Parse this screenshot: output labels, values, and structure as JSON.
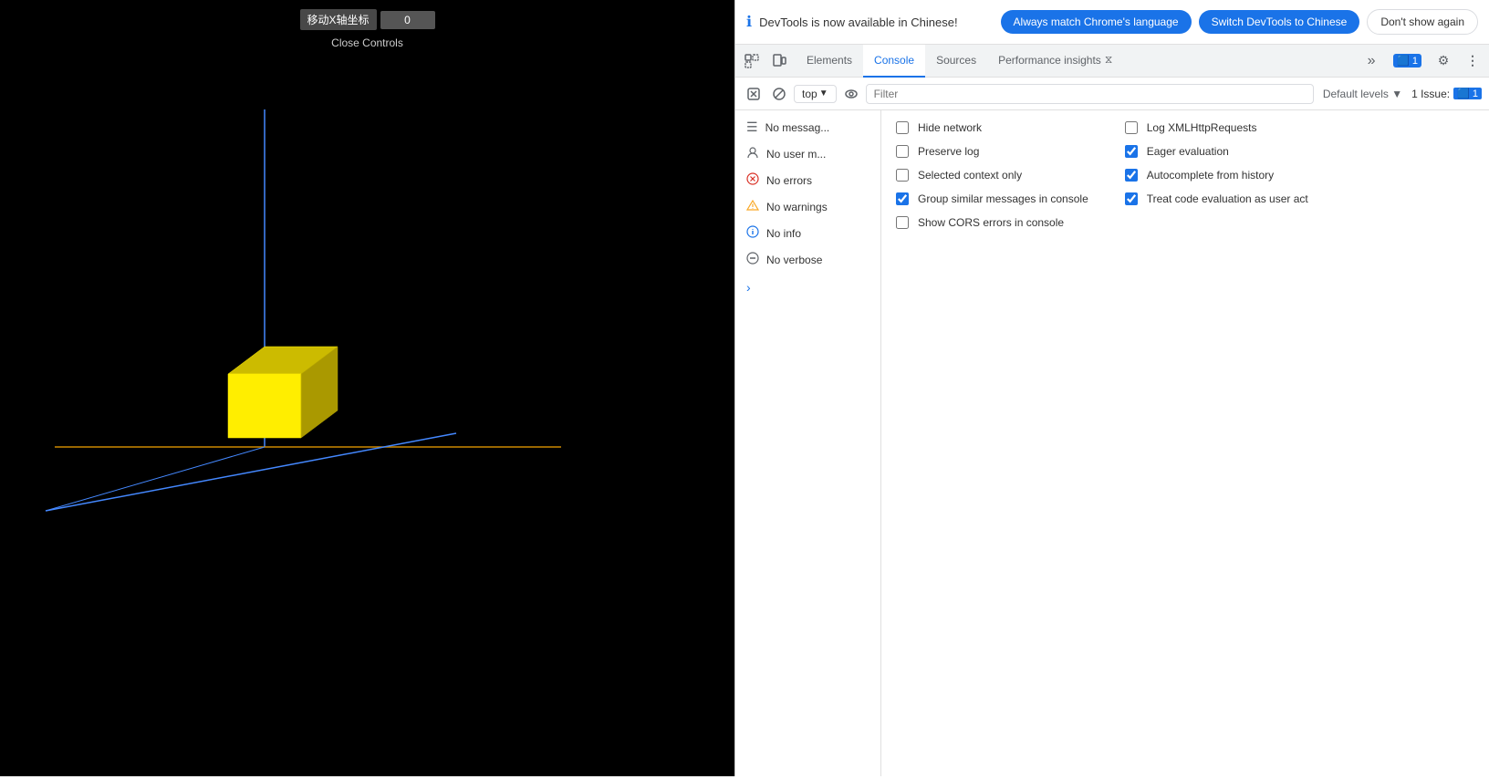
{
  "scene": {
    "toolbar_label": "移动X轴坐标",
    "toolbar_value": "0",
    "close_controls": "Close Controls"
  },
  "devtools": {
    "notification": {
      "icon": "ℹ",
      "text": "DevTools is now available in Chinese!",
      "btn_match": "Always match Chrome's language",
      "btn_switch": "Switch DevTools to Chinese",
      "btn_dismiss": "Don't show again"
    },
    "tabs": [
      {
        "id": "elements",
        "label": "Elements",
        "active": false
      },
      {
        "id": "console",
        "label": "Console",
        "active": true
      },
      {
        "id": "sources",
        "label": "Sources",
        "active": false
      },
      {
        "id": "performance",
        "label": "Performance insights ⚡",
        "active": false
      }
    ],
    "tab_icons": {
      "select": "⬚",
      "device": "📱",
      "more": "»",
      "issues_count": "1",
      "issues_label": "🟦 1",
      "settings": "⚙",
      "menu": "⋮"
    },
    "console": {
      "clear_btn": "🚫",
      "top_label": "top",
      "eye_icon": "👁",
      "filter_placeholder": "Filter",
      "default_levels": "Default levels ▼",
      "issue_text": "1 Issue:",
      "issue_badge": "🟦 1"
    },
    "log_items": [
      {
        "id": "messages",
        "icon": "☰",
        "label": "No messag...",
        "icon_class": "messages"
      },
      {
        "id": "user",
        "icon": "😊",
        "label": "No user m...",
        "icon_class": "user"
      },
      {
        "id": "errors",
        "icon": "⊗",
        "label": "No errors",
        "icon_class": "errors"
      },
      {
        "id": "warnings",
        "icon": "⚠",
        "label": "No warnings",
        "icon_class": "warnings"
      },
      {
        "id": "info",
        "icon": "ℹ",
        "label": "No info",
        "icon_class": "info"
      },
      {
        "id": "verbose",
        "icon": "⚙",
        "label": "No verbose",
        "icon_class": "verbose"
      }
    ],
    "filter_options": [
      {
        "id": "hide_network",
        "label": "Hide network",
        "checked": false
      },
      {
        "id": "preserve_log",
        "label": "Preserve log",
        "checked": false
      },
      {
        "id": "selected_context",
        "label": "Selected context only",
        "checked": false
      },
      {
        "id": "group_similar",
        "label": "Group similar messages in console",
        "checked": true
      },
      {
        "id": "show_cors",
        "label": "Show CORS errors in console",
        "checked": false
      }
    ],
    "filter_options_right": [
      {
        "id": "log_xml",
        "label": "Log XMLHttpRequests",
        "checked": false
      },
      {
        "id": "eager_eval",
        "label": "Eager evaluation",
        "checked": true
      },
      {
        "id": "autocomplete",
        "label": "Autocomplete from history",
        "checked": true
      },
      {
        "id": "treat_code",
        "label": "Treat code evaluation as user act",
        "checked": true
      }
    ]
  }
}
